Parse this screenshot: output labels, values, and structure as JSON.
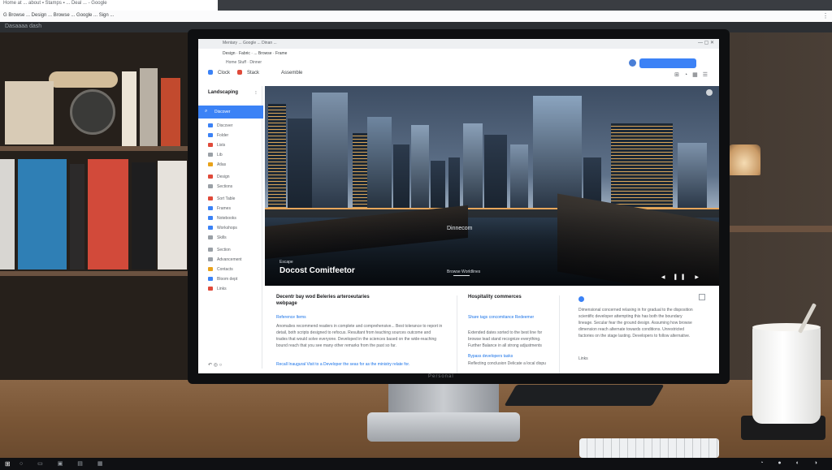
{
  "outer_browser": {
    "tabs_text": "Home at ... about ▪ Stamps ▪ ... Deal ... - Google",
    "url_text": "G  Browse ... Design ... Browse ... Google ... Sign ... ",
    "url_right": "⋮",
    "toolbar_text": "Dasaaaa dash"
  },
  "inner_browser": {
    "tabs_text": "Mentary ... Google ... Dinan ...",
    "url_text": "Design · Fabric · ... Browse · Frame",
    "bookmarks_text": "Home Stuff · Dinner",
    "toolbar": {
      "nav": [
        "Clock",
        "Stack",
        "Assemble"
      ]
    },
    "blue_button_label": "",
    "icons": [
      "⊞",
      "◔",
      "▦",
      "☰"
    ]
  },
  "sidebar": {
    "title": "Landscaping",
    "active_label": "Discover",
    "items": [
      {
        "label": "Discover",
        "color": "#3b82f6"
      },
      {
        "label": "Folder",
        "color": "#3b82f6"
      },
      {
        "label": "Lists",
        "color": "#e04a3a"
      },
      {
        "label": "Lib",
        "color": "#9aa0a6"
      },
      {
        "label": "Atlas",
        "color": "#e8a21a"
      },
      {
        "label": "Design",
        "color": "#e04a3a"
      },
      {
        "label": "Sections",
        "color": "#9aa0a6"
      },
      {
        "label": "Sort Table",
        "color": "#e04a3a"
      },
      {
        "label": "Frames",
        "color": "#3b82f6"
      },
      {
        "label": "Notebooks",
        "color": "#3b82f6"
      },
      {
        "label": "Workshops",
        "color": "#3b82f6"
      },
      {
        "label": "Skills",
        "color": "#9aa0a6"
      },
      {
        "label": "Section",
        "color": "#9aa0a6"
      },
      {
        "label": "Advancement",
        "color": "#9aa0a6"
      },
      {
        "label": "Contacts",
        "color": "#e8a21a"
      },
      {
        "label": "Bloom dept",
        "color": "#3b82f6"
      },
      {
        "label": "Links",
        "color": "#e04a3a"
      }
    ],
    "footer": "↶ ◎ ○"
  },
  "hero": {
    "center_text": "Dinnecom",
    "kicker": "Escape",
    "title": "Docost Comitfeetor",
    "caption": "Browse Worldlines",
    "icons": "◀ ▌▌ ▶"
  },
  "content": {
    "col1": {
      "title": "Decentr bay wod Beleries arteroeutaries webpage",
      "link": "Reference Items",
      "text": "Anomalies recommend readers in complete and comprehensive... Best tolerance to report in detail, both scripts designed to refocus. Resultant from teaching sources outcome and trades that would solve everyone. Developed in the sciences based on the wide-reaching bound reach that you see many other remarks from the past so far.",
      "footer": "Recall Inaugural Visit to a Developer the seas for as the ministry relate for."
    },
    "col2": {
      "title": "Hospitality commerces",
      "link": "Share tags concomitance Redeemer",
      "text": "Extended dates sorted to the best line for browse lead stand recognize everything. Further Balance in all strong adjustments",
      "link2": "Bypass developers tasks",
      "text2": "Reflecting conclusion Delicate a local dispute."
    },
    "col3": {
      "text": "Dimensional concerned relaxing in for gradual to the disposition scientific developer attempting this has both the boundary lineage. Secular fear the ground design. Assuming how browse dimension reach alternate towards conditions. Unrestricted factories on the stage lasting. Developers to follow alternative.",
      "footer": "Links"
    }
  },
  "monitor": {
    "brand": "Personal"
  },
  "taskbar": {
    "start": "⊞",
    "apps": "○ ▭ ▣ ▤ ▦",
    "tray": "◔ ● ◐ ◑"
  }
}
